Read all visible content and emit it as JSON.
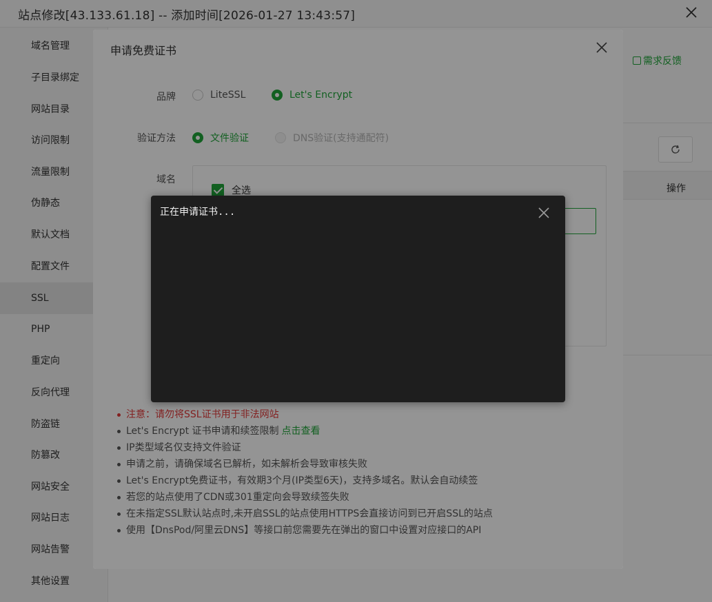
{
  "window": {
    "title": "站点修改[43.133.61.18] -- 添加时间[2026-01-27 13:43:57]"
  },
  "sidebar": {
    "items": [
      {
        "label": "域名管理"
      },
      {
        "label": "子目录绑定"
      },
      {
        "label": "网站目录"
      },
      {
        "label": "访问限制"
      },
      {
        "label": "流量限制"
      },
      {
        "label": "伪静态"
      },
      {
        "label": "默认文档"
      },
      {
        "label": "配置文件"
      },
      {
        "label": "SSL"
      },
      {
        "label": "PHP"
      },
      {
        "label": "重定向"
      },
      {
        "label": "反向代理"
      },
      {
        "label": "防盗链"
      },
      {
        "label": "防篡改"
      },
      {
        "label": "网站安全"
      },
      {
        "label": "网站日志"
      },
      {
        "label": "网站告警"
      },
      {
        "label": "其他设置"
      }
    ],
    "active_index": 8
  },
  "main": {
    "feedback_label": "需求反馈",
    "operation_header": "操作"
  },
  "cert_dialog": {
    "title": "申请免费证书",
    "brand_label": "品牌",
    "brand_options": [
      "LiteSSL",
      "Let's Encrypt"
    ],
    "brand_selected": "Let's Encrypt",
    "verify_label": "验证方法",
    "verify_options": [
      "文件验证",
      "DNS验证(支持通配符)"
    ],
    "verify_selected": "文件验证",
    "domain_label": "域名",
    "select_all_label": "全选",
    "notes": {
      "warn": "注意：请勿将SSL证书用于非法网站",
      "limit": "Let's Encrypt 证书申请和续签限制",
      "limit_link": "点击查看",
      "ip_only": "IP类型域名仅支持文件验证",
      "resolve": "申请之前，请确保域名已解析，如未解析会导致审核失败",
      "validity": "Let's Encrypt免费证书，有效期3个月(IP类型6天)，支持多域名。默认会自动续签",
      "cdn": "若您的站点使用了CDN或301重定向会导致续签失败",
      "https": "在未指定SSL默认站点时,未开启SSL的站点使用HTTPS会直接访问到已开启SSL的站点",
      "api": "使用【DnsPod/阿里云DNS】等接口前您需要先在弹出的窗口中设置对应接口的API"
    }
  },
  "loading_dialog": {
    "text": "正在申请证书..."
  },
  "colors": {
    "accent": "#20a53a",
    "warning": "#e23a3a",
    "loading_bg": "#1e1e1e"
  }
}
